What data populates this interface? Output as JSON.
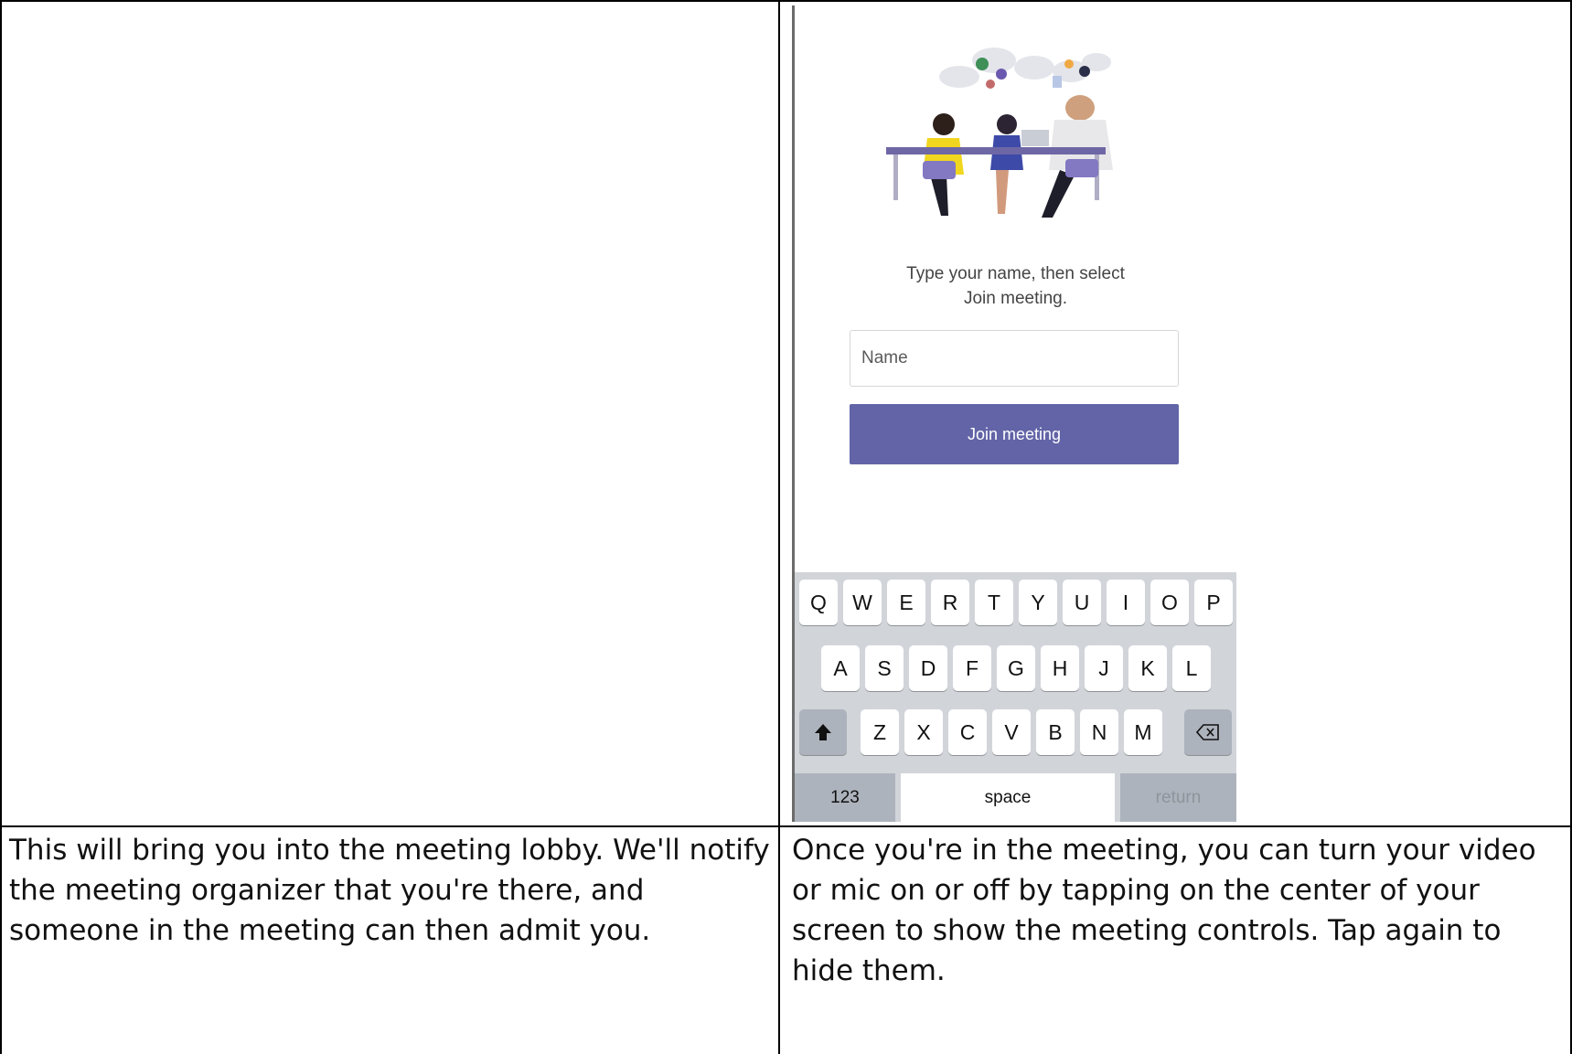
{
  "cells": {
    "bottom_left": "This will bring you into the meeting lobby. We'll notify the meeting organizer that you're there, and someone in the meeting can then admit you.",
    "bottom_right": "Once you're in the meeting, you can turn your video or mic on or off by tapping on the center of your screen to show the meeting controls. Tap again to hide them."
  },
  "phone": {
    "prompt_line1": "Type your name, then select",
    "prompt_line2": "Join meeting.",
    "name_placeholder": "Name",
    "join_label": "Join meeting",
    "accent_color": "#6264a7",
    "keyboard": {
      "row1": [
        "Q",
        "W",
        "E",
        "R",
        "T",
        "Y",
        "U",
        "I",
        "O",
        "P"
      ],
      "row2": [
        "A",
        "S",
        "D",
        "F",
        "G",
        "H",
        "J",
        "K",
        "L"
      ],
      "row3": [
        "Z",
        "X",
        "C",
        "V",
        "B",
        "N",
        "M"
      ],
      "shift_icon": "shift-arrow-icon",
      "delete_icon": "backspace-icon",
      "numbers_label": "123",
      "space_label": "space",
      "return_label": "return"
    }
  }
}
